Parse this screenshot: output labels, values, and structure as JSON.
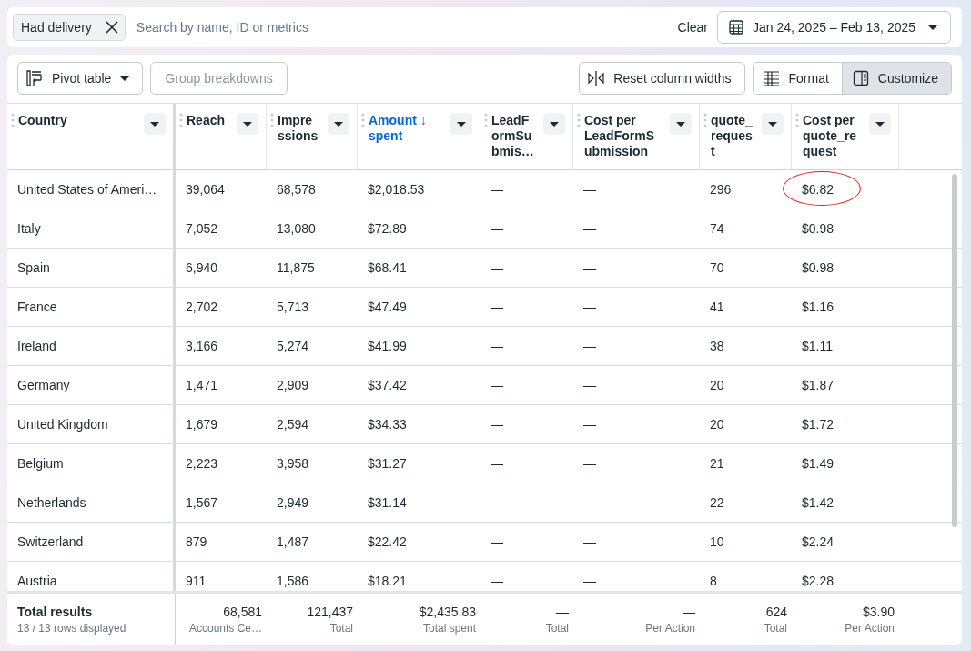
{
  "filter_bar": {
    "chips": [
      {
        "label": "Had delivery"
      }
    ],
    "search": {
      "placeholder": "Search by name, ID or metrics"
    },
    "clear": "Clear",
    "date_range": "Jan 24, 2025 – Feb 13, 2025"
  },
  "toolbar": {
    "left": [
      {
        "label": "Pivot table",
        "kind": "dropdown",
        "disabled": false
      },
      {
        "label": "Group breakdowns",
        "kind": "plain",
        "disabled": true
      }
    ],
    "reset": "Reset column widths",
    "views": [
      {
        "label": "Format",
        "kind": "format",
        "selected": false
      },
      {
        "label": "Customize",
        "kind": "customize",
        "selected": true
      }
    ]
  },
  "table": {
    "columns": [
      {
        "label": "Country",
        "sorted": false
      },
      {
        "label": "Reach",
        "sorted": false
      },
      {
        "label": "Impressions",
        "sorted": false
      },
      {
        "label": "Amount ↓ spent",
        "sorted": true
      },
      {
        "label": "LeadFormSubmis…",
        "sorted": false
      },
      {
        "label": "Cost per LeadFormSubmission",
        "sorted": false
      },
      {
        "label": "quote_request",
        "sorted": false
      },
      {
        "label": "Cost per quote_request",
        "sorted": false
      }
    ],
    "rows": [
      {
        "cells": [
          "United States of Ameri…",
          "39,064",
          "68,578",
          "$2,018.53",
          "—",
          "—",
          "296",
          {
            "text": "$6.82",
            "circled": true
          }
        ]
      },
      {
        "cells": [
          "Italy",
          "7,052",
          "13,080",
          "$72.89",
          "—",
          "—",
          "74",
          "$0.98"
        ]
      },
      {
        "cells": [
          "Spain",
          "6,940",
          "11,875",
          "$68.41",
          "—",
          "—",
          "70",
          "$0.98"
        ]
      },
      {
        "cells": [
          "France",
          "2,702",
          "5,713",
          "$47.49",
          "—",
          "—",
          "41",
          "$1.16"
        ]
      },
      {
        "cells": [
          "Ireland",
          "3,166",
          "5,274",
          "$41.99",
          "—",
          "—",
          "38",
          "$1.11"
        ]
      },
      {
        "cells": [
          "Germany",
          "1,471",
          "2,909",
          "$37.42",
          "—",
          "—",
          "20",
          "$1.87"
        ]
      },
      {
        "cells": [
          "United Kingdom",
          "1,679",
          "2,594",
          "$34.33",
          "—",
          "—",
          "20",
          "$1.72"
        ]
      },
      {
        "cells": [
          "Belgium",
          "2,223",
          "3,958",
          "$31.27",
          "—",
          "—",
          "21",
          "$1.49"
        ]
      },
      {
        "cells": [
          "Netherlands",
          "1,567",
          "2,949",
          "$31.14",
          "—",
          "—",
          "22",
          "$1.42"
        ]
      },
      {
        "cells": [
          "Switzerland",
          "879",
          "1,487",
          "$22.42",
          "—",
          "—",
          "10",
          "$2.24"
        ]
      },
      {
        "cells": [
          "Austria",
          "911",
          "1,586",
          "$18.21",
          "—",
          "—",
          "8",
          "$2.28"
        ]
      }
    ],
    "totals": {
      "title": "Total results",
      "subtitle": "13 / 13 rows displayed",
      "values": [
        {
          "value": "68,581",
          "label": "Accounts Ce…"
        },
        {
          "value": "121,437",
          "label": "Total"
        },
        {
          "value": "$2,435.83",
          "label": "Total spent"
        },
        {
          "value": "—",
          "label": "Total"
        },
        {
          "value": "—",
          "label": "Per Action"
        },
        {
          "value": "624",
          "label": "Total"
        },
        {
          "value": "$3.90",
          "label": "Per Action"
        }
      ]
    }
  }
}
